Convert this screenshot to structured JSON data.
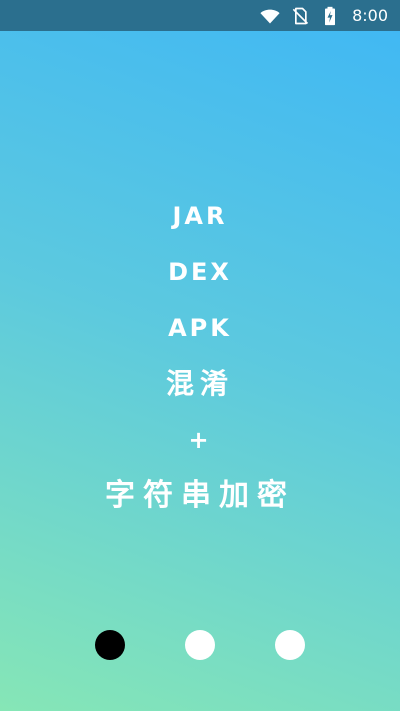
{
  "status_bar": {
    "time": "8:00",
    "icons": [
      "wifi-icon",
      "no-sim-icon",
      "battery-charging-icon"
    ]
  },
  "features": [
    {
      "label": "JAR"
    },
    {
      "label": "DEX"
    },
    {
      "label": "APK"
    },
    {
      "label": "混淆"
    },
    {
      "label": "+"
    },
    {
      "label": "字符串加密"
    }
  ],
  "pager": {
    "page_count": 3,
    "active_index": 0
  },
  "colors": {
    "gradient_top": "#3fb7f5",
    "gradient_mid": "#5cc9df",
    "gradient_bottom": "#86e6b6",
    "status_bar": "#2b6f8e",
    "dot_active": "#000000",
    "dot_inactive": "#ffffff"
  }
}
